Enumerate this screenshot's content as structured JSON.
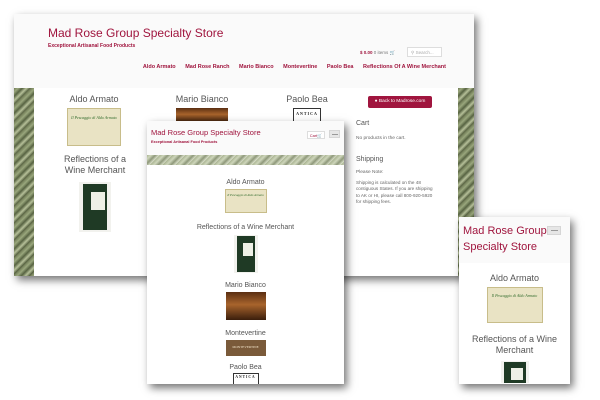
{
  "brand": {
    "title": "Mad Rose Group Specialty Store",
    "tagline": "Exceptional Artisanal Food Products",
    "title_line1": "Mad Rose Group",
    "title_line2": "Specialty Store"
  },
  "desktop": {
    "cart_total": "$ 0.00",
    "cart_items": "0 items",
    "search_placeholder": "Search...",
    "nav": [
      "Aldo Armato",
      "Mad Rose Ranch",
      "Mario Bianco",
      "Montevertine",
      "Paolo Bea",
      "Reflections Of A Wine Merchant"
    ],
    "products": [
      "Aldo Armato",
      "Mario Bianco",
      "Paolo Bea",
      "Reflections of a",
      "Wine Merchant"
    ],
    "back_button": "Back to Madrose.com",
    "cart_heading": "Cart",
    "cart_empty": "No products in the cart.",
    "shipping_heading": "Shipping",
    "shipping_note": "Please Note:",
    "shipping_lines": [
      "Shipping is calculated on the 48",
      "contiguous States. If you are shipping",
      "to AK or HI, please call 800-920-5920",
      "for shipping fees."
    ]
  },
  "tablet": {
    "cart_button": "Cart",
    "products": [
      "Aldo Armato",
      "Reflections of a Wine Merchant",
      "Mario Bianco",
      "Montevertine",
      "Paolo Bea"
    ]
  },
  "mobile": {
    "products": [
      "Aldo Armato",
      "Reflections of a Wine",
      "Merchant"
    ]
  },
  "images": {
    "logo_text": "Il Pescaggio di Aldo Armato",
    "wine_text": "MONTEVERTINE",
    "antica_text": "ANTICA",
    "antica_sub": "TERRE"
  },
  "colors": {
    "brand": "#a0153e",
    "button_bg": "#a0153e"
  },
  "icons": [
    "cart-icon",
    "search-icon",
    "menu-toggle-icon"
  ]
}
